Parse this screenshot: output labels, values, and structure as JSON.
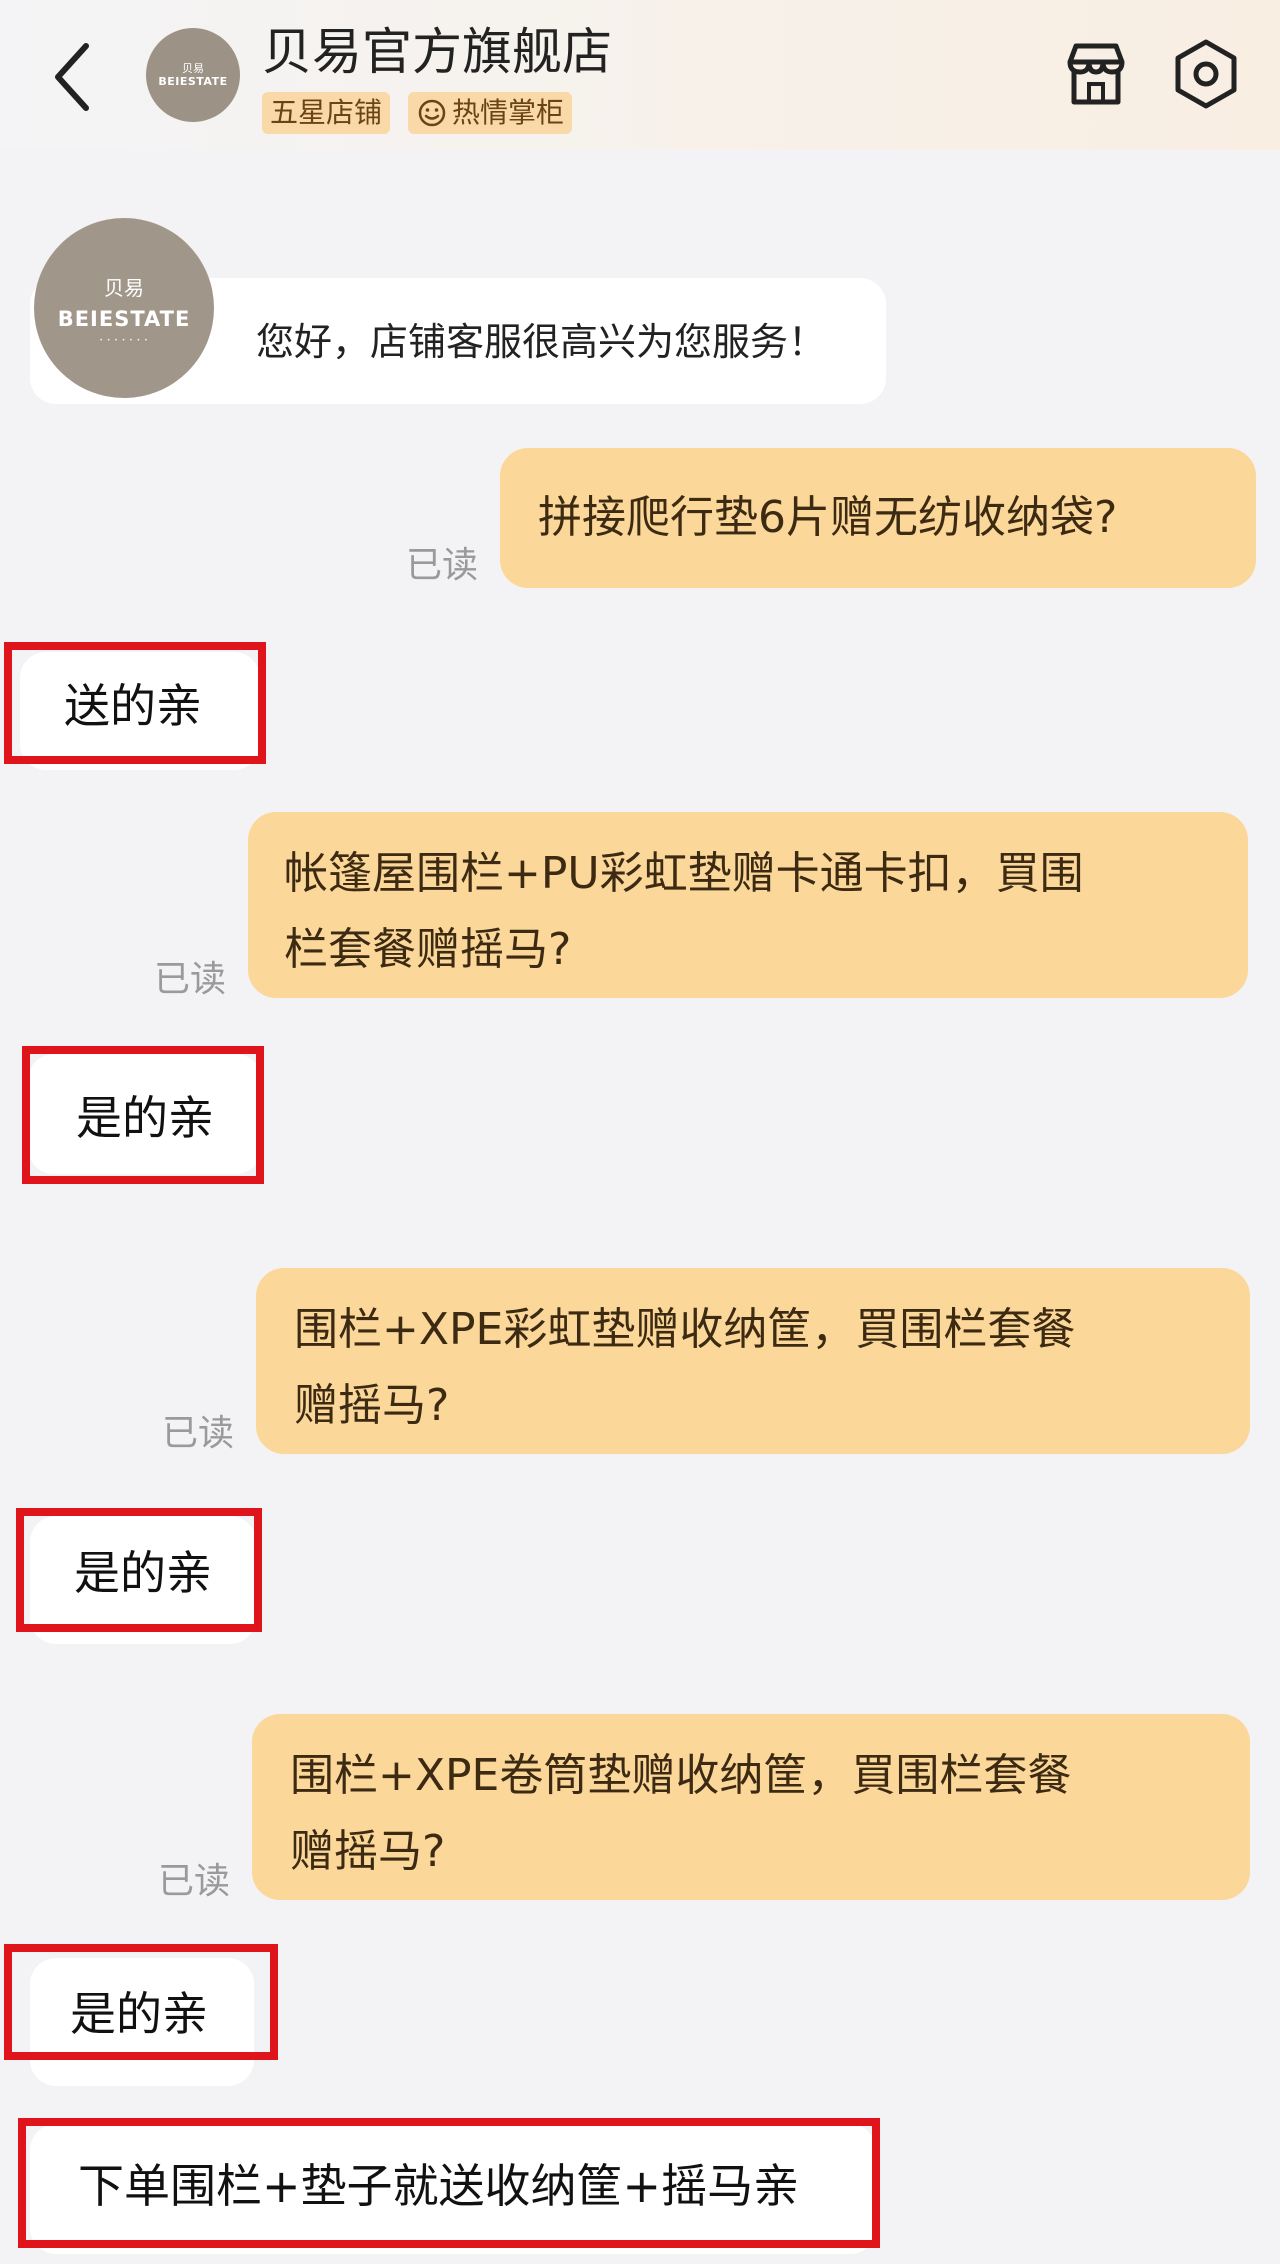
{
  "header": {
    "store_name": "贝易官方旗舰店",
    "badge_five_star": "五星店铺",
    "badge_warm": "热情掌柜",
    "avatar_text_cn": "贝易",
    "avatar_text_en": "BEIESTATE",
    "back_icon": "chevron-left-icon",
    "shop_icon": "shop-icon",
    "settings_icon": "settings-icon"
  },
  "welcome": {
    "avatar_text_cn": "贝易",
    "avatar_text_en": "BEIESTATE",
    "message": "您好，店铺客服很高兴为您服务！"
  },
  "messages": [
    {
      "from": "user",
      "text": "拼接爬行垫6片赠无纺收纳袋?",
      "status": "已读"
    },
    {
      "from": "shop",
      "text": "送的亲"
    },
    {
      "from": "user",
      "text_line1": "帐篷屋围栏+PU彩虹垫赠卡通卡扣，買围",
      "text_line2": "栏套餐赠摇马?",
      "status": "已读"
    },
    {
      "from": "shop",
      "text": "是的亲"
    },
    {
      "from": "user",
      "text_line1": "围栏+XPE彩虹垫赠收纳筐，買围栏套餐",
      "text_line2": "赠摇马?",
      "status": "已读"
    },
    {
      "from": "shop",
      "text": "是的亲"
    },
    {
      "from": "user",
      "text_line1": "围栏+XPE卷筒垫赠收纳筐，買围栏套餐",
      "text_line2": "赠摇马?",
      "status": "已读"
    },
    {
      "from": "shop",
      "text": "是的亲"
    },
    {
      "from": "shop",
      "text": "下单围栏+垫子就送收纳筐+摇马亲"
    }
  ],
  "colors": {
    "outgoing_bubble": "#fbd79a",
    "incoming_bubble": "#ffffff",
    "highlight_border": "#e0141b",
    "badge_bg": "#f9d9a8"
  }
}
